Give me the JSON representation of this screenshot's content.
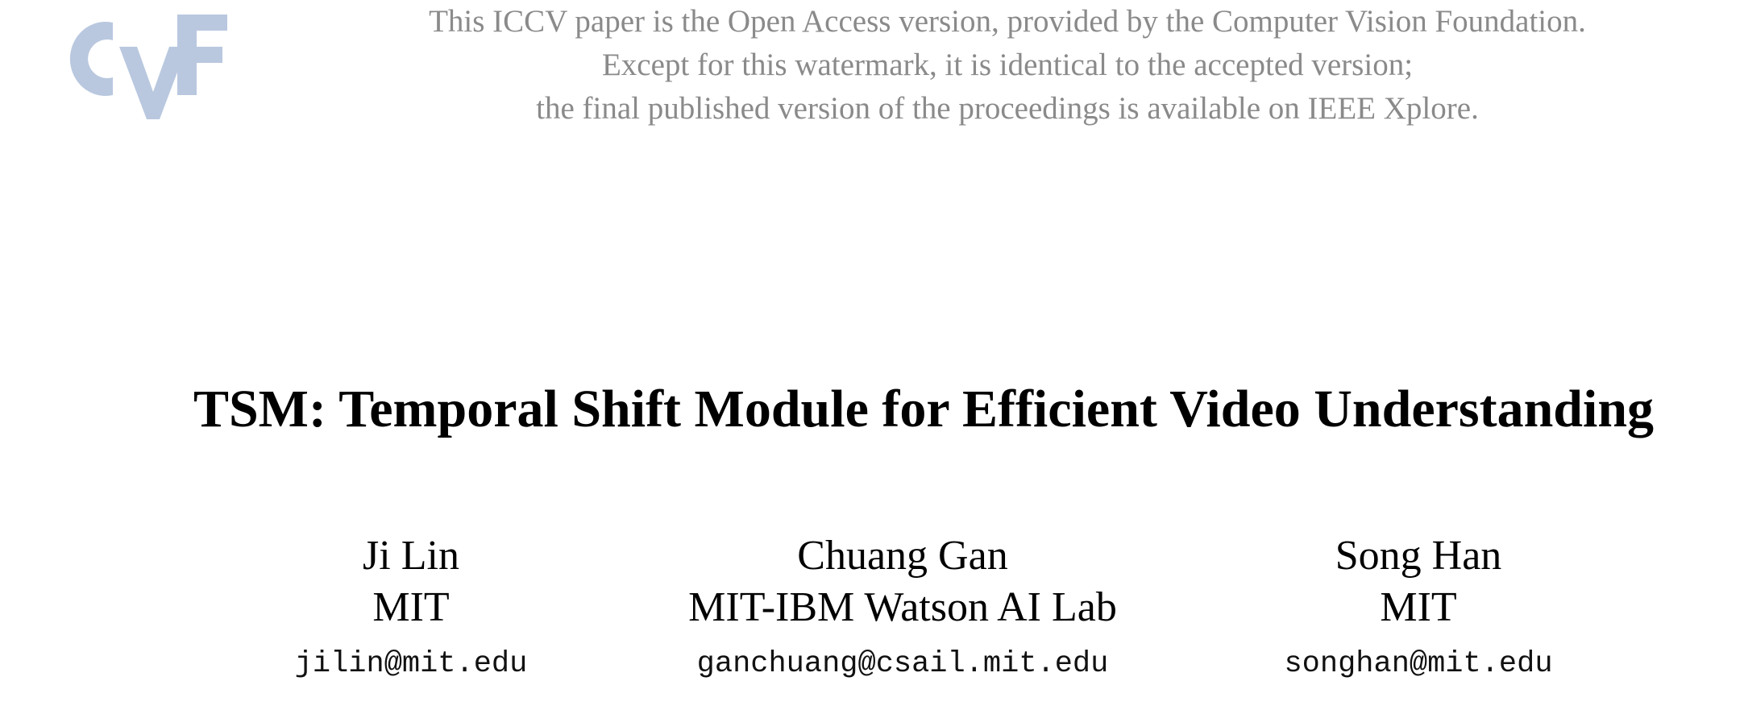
{
  "watermark": {
    "logo_label": "CVF",
    "lines": [
      "This ICCV paper is the Open Access version, provided by the Computer Vision Foundation.",
      "Except for this watermark, it is identical to the accepted version;",
      "the final published version of the proceedings is available on IEEE Xplore."
    ],
    "logo_color": "#b9c8df",
    "text_color": "#8a8a8a"
  },
  "paper": {
    "title": "TSM: Temporal Shift Module for Efficient Video Understanding",
    "authors": [
      {
        "name": "Ji Lin",
        "affiliation": "MIT",
        "email": "jilin@mit.edu"
      },
      {
        "name": "Chuang Gan",
        "affiliation": "MIT-IBM Watson AI Lab",
        "email": "ganchuang@csail.mit.edu"
      },
      {
        "name": "Song Han",
        "affiliation": "MIT",
        "email": "songhan@mit.edu"
      }
    ]
  }
}
